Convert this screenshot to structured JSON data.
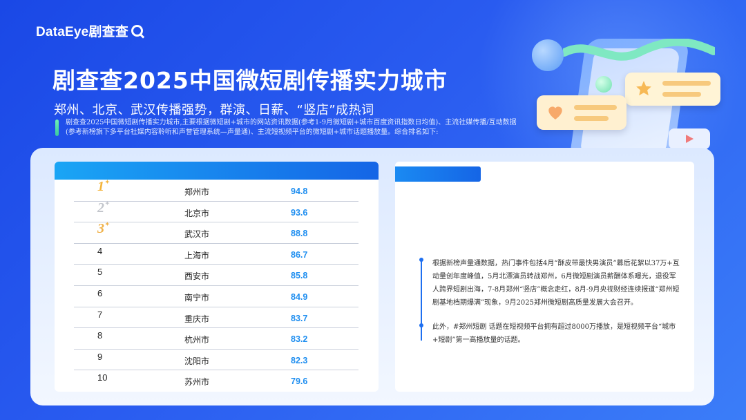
{
  "brand": {
    "logo_text": "DataEye剧查查"
  },
  "header": {
    "title": "剧查查2025中国微短剧传播实力城市",
    "subtitle": "郑州、北京、武汉传播强势，群演、日薪、“竖店”成热词",
    "description": "剧查查2025中国微短剧传播实力城市,主要根据微短剧+城市的网站资讯数据(参考1-9月微短剧+城市百度资讯指数日均值)、主流社媒传播/互动数据(参考新榜旗下多平台社媒内容聆听和声誉管理系统—声量通)、主流短视频平台的微短剧+城市话题播放量。综合排名如下:"
  },
  "ranking": {
    "rows": [
      {
        "rank": "1",
        "city": "郑州市",
        "score": "94.8",
        "medal": "gold"
      },
      {
        "rank": "2",
        "city": "北京市",
        "score": "93.6",
        "medal": "silver"
      },
      {
        "rank": "3",
        "city": "武汉市",
        "score": "88.8",
        "medal": "bronze"
      },
      {
        "rank": "4",
        "city": "上海市",
        "score": "86.7",
        "medal": ""
      },
      {
        "rank": "5",
        "city": "西安市",
        "score": "85.8",
        "medal": ""
      },
      {
        "rank": "6",
        "city": "南宁市",
        "score": "84.9",
        "medal": ""
      },
      {
        "rank": "7",
        "city": "重庆市",
        "score": "83.7",
        "medal": ""
      },
      {
        "rank": "8",
        "city": "杭州市",
        "score": "83.2",
        "medal": ""
      },
      {
        "rank": "9",
        "city": "沈阳市",
        "score": "82.3",
        "medal": ""
      },
      {
        "rank": "10",
        "city": "苏州市",
        "score": "79.6",
        "medal": ""
      }
    ]
  },
  "notes": {
    "paragraph1": "根据新榜声量通数据，热门事件包括4月“酥皮带最快男演员”幕后花絮以37万+互动量创年度峰值，5月北漂演员转战郑州，6月微短剧演员薪酬体系曝光，退役军人跨界短剧出海，7-8月郑州“竖店”概念走红，8月-9月央视财经连续报道“郑州短剧基地档期爆满”现象，9月2025郑州微短剧高质量发展大会召开。",
    "paragraph2": "此外，#郑州短剧 话题在短视频平台拥有超过8000万播放，是短视频平台“城市+短剧”第一高播放量的话题。"
  },
  "colors": {
    "accent": "#1e6ff0",
    "score": "#1e8ef0",
    "gold": "#f4b43c"
  }
}
